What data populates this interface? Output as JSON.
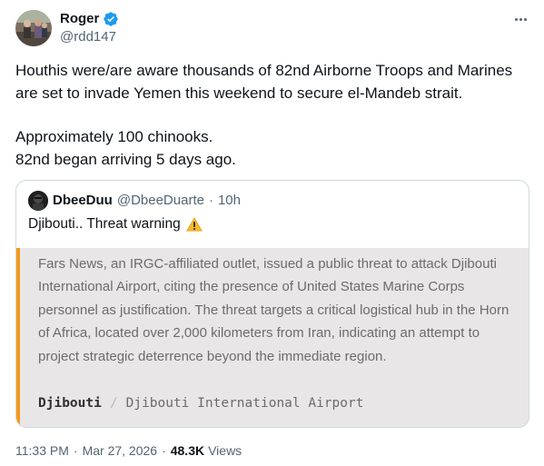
{
  "author": {
    "display_name": "Roger",
    "handle": "@rdd147"
  },
  "tweet": {
    "paragraphs": [
      "Houthis were/are aware thousands of 82nd Airborne Troops and Marines are set to invade Yemen this weekend to secure el-Mandeb strait.",
      "Approximately 100 chinooks.\n82nd began arriving 5 days ago."
    ]
  },
  "quote": {
    "display_name": "DbeeDuu",
    "handle": "@DbeeDuarte",
    "separator": "·",
    "time": "10h",
    "text": "Djibouti.. Threat warning",
    "emoji": "warning-emoji",
    "card": {
      "text": "Fars News, an IRGC-affiliated outlet, issued a public threat to attack Djibouti International Airport, citing the presence of United States Marine Corps personnel as justification. The threat targets a critical logistical hub in the Horn of Africa, located over 2,000 kilometers from Iran, indicating an attempt to project strategic deterrence beyond the immediate region.",
      "site": "Djibouti",
      "separator": "/",
      "crumb": "Djibouti International Airport",
      "accent_color": "#f29a1f"
    }
  },
  "meta": {
    "time": "11:33 PM",
    "separator": "·",
    "date": "Mar 27, 2026",
    "separator2": "·",
    "views_count": "48.3K",
    "views_label": "Views"
  },
  "colors": {
    "verified": "#1d9bf0",
    "secondary_text": "#536471",
    "card_bg": "#e8e6e6"
  }
}
